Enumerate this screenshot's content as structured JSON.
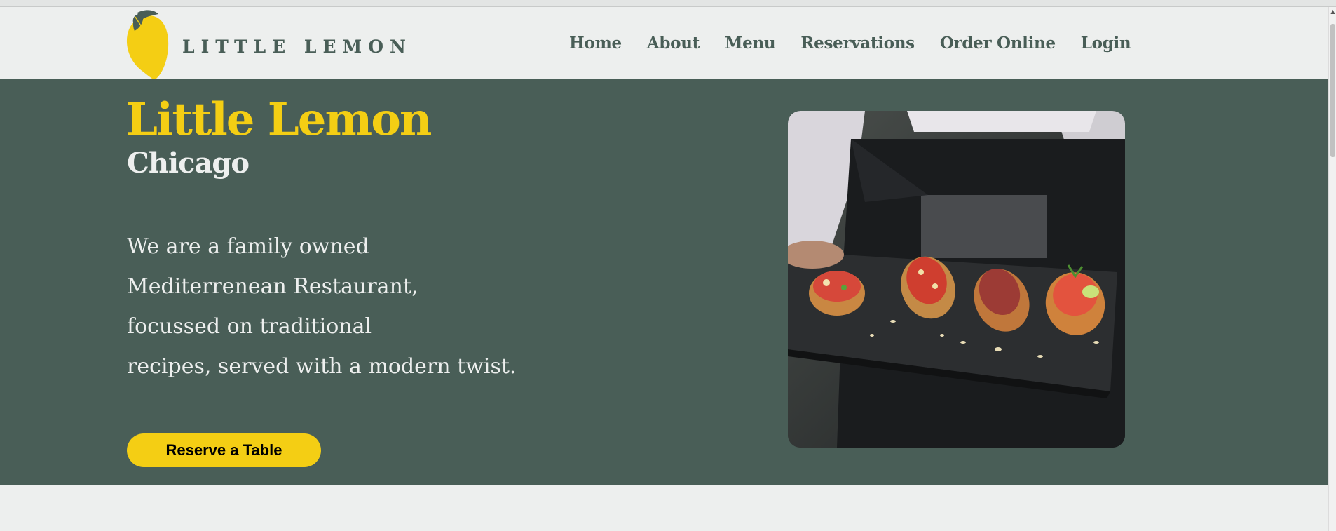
{
  "brand": {
    "logo_text": "LITTLE LEMON",
    "primary_color": "#495e57",
    "accent_color": "#f4ce14"
  },
  "nav": {
    "items": [
      {
        "label": "Home"
      },
      {
        "label": "About"
      },
      {
        "label": "Menu"
      },
      {
        "label": "Reservations"
      },
      {
        "label": "Order Online"
      },
      {
        "label": "Login"
      }
    ]
  },
  "hero": {
    "title": "Little Lemon",
    "subtitle": "Chicago",
    "description_lines": [
      "We are a family owned",
      "Mediterrenean Restaurant,",
      "focussed on traditional",
      "recipes, served with a modern twist."
    ],
    "cta_label": "Reserve a Table",
    "image_icon": "food-photo"
  }
}
